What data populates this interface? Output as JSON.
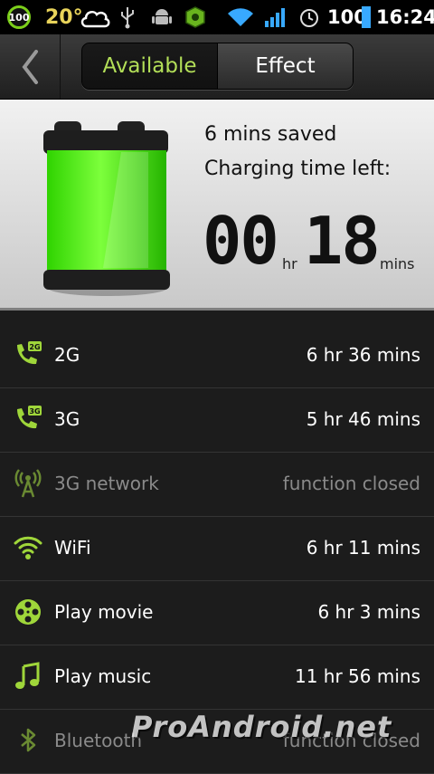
{
  "status_bar": {
    "badge": "100",
    "temperature": "20°",
    "battery_percent": "100",
    "time": "16:24",
    "icons": [
      "battery-badge-icon",
      "temperature-icon",
      "cloud-icon",
      "usb-icon",
      "android-icon",
      "app-icon",
      "wifi-icon",
      "signal-icon",
      "alarm-icon",
      "battery-icon"
    ]
  },
  "nav": {
    "tabs": [
      {
        "label": "Available"
      },
      {
        "label": "Effect"
      }
    ]
  },
  "battery": {
    "saved": "6 mins saved",
    "charging_label": "Charging time left:",
    "hours": "00",
    "hr_unit": "hr",
    "minutes": "18",
    "min_unit": "mins",
    "fill_color": "#3cf000"
  },
  "rows": [
    {
      "icon": "phone-2g-icon",
      "label": "2G",
      "value": "6 hr 36 mins",
      "enabled": true
    },
    {
      "icon": "phone-3g-icon",
      "label": "3G",
      "value": "5 hr 46 mins",
      "enabled": true
    },
    {
      "icon": "network-antenna-icon",
      "label": "3G network",
      "value": "function closed",
      "enabled": false
    },
    {
      "icon": "wifi-icon",
      "label": "WiFi",
      "value": "6 hr 11 mins",
      "enabled": true
    },
    {
      "icon": "film-reel-icon",
      "label": "Play movie",
      "value": "6 hr 3 mins",
      "enabled": true
    },
    {
      "icon": "music-note-icon",
      "label": "Play music",
      "value": "11 hr 56 mins",
      "enabled": true
    },
    {
      "icon": "bluetooth-icon",
      "label": "Bluetooth",
      "value": "function closed",
      "enabled": false
    }
  ],
  "watermark": "ProAndroid.net",
  "accent_color": "#9fd63a"
}
